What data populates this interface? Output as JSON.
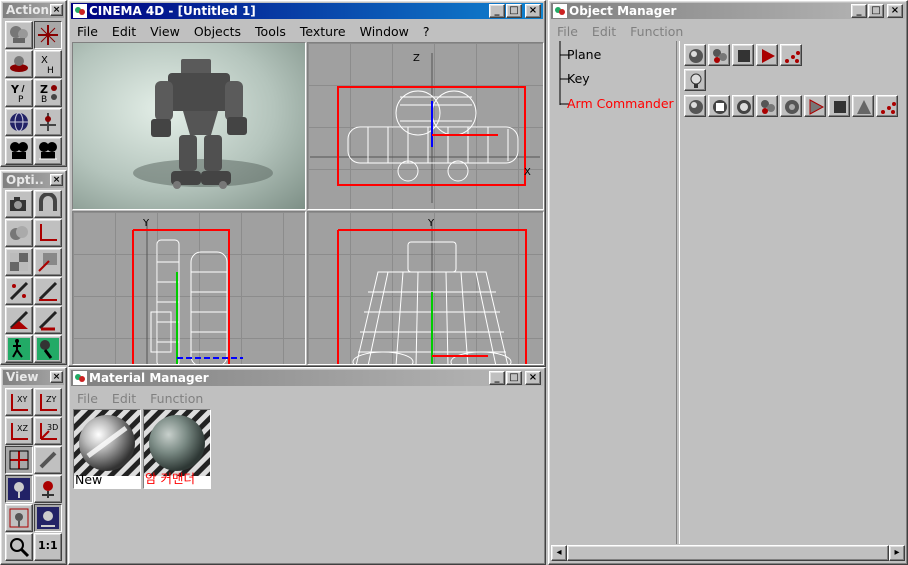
{
  "palettes": {
    "action": {
      "title": "Action",
      "close": "×"
    },
    "options": {
      "title": "Opti..",
      "close": "×"
    },
    "view": {
      "title": "View",
      "close": "×"
    }
  },
  "main_window": {
    "title": "CINEMA 4D - [Untitled 1]",
    "menu": [
      "File",
      "Edit",
      "View",
      "Objects",
      "Tools",
      "Texture",
      "Window",
      "?"
    ],
    "btns": [
      "_",
      "□",
      "×"
    ]
  },
  "viewports": {
    "top_axis_z": "Z",
    "top_axis_x": "X",
    "side_axis_y": "Y",
    "front_axis_y": "Y"
  },
  "object_manager": {
    "title": "Object Manager",
    "menu": [
      "File",
      "Edit",
      "Function"
    ],
    "objects": [
      {
        "name": "Plane",
        "color": "#000000"
      },
      {
        "name": "Key",
        "color": "#000000"
      },
      {
        "name": "Arm Commander",
        "color": "#ff0000"
      }
    ],
    "btns": [
      "_",
      "□",
      "×"
    ],
    "scroll_left": "◂",
    "scroll_right": "▸"
  },
  "material_manager": {
    "title": "Material Manager",
    "menu": [
      "File",
      "Edit",
      "Function"
    ],
    "materials": [
      {
        "name": "New",
        "color": "#000000"
      },
      {
        "name": "암 커맨더",
        "color": "#ff0000"
      }
    ],
    "btns": [
      "_",
      "□",
      "×"
    ]
  },
  "view_tools": [
    "XY",
    "ZY",
    "XZ",
    "3D"
  ],
  "zoom_label": "1:1",
  "colors": {
    "active_title": "#000080",
    "inactive_title": "#808080",
    "highlight_object": "#ff0000",
    "selection_box": "#ff0000"
  }
}
